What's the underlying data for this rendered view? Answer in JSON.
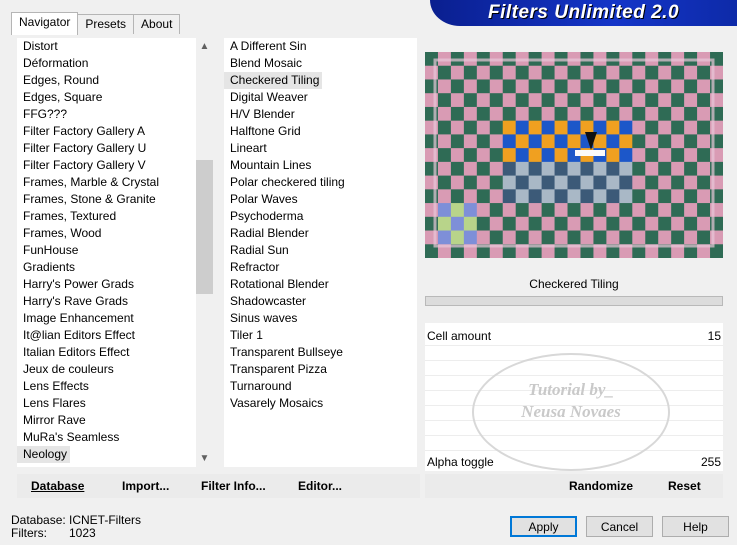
{
  "app": {
    "title": "Filters Unlimited 2.0"
  },
  "tabs": [
    {
      "label": "Navigator"
    },
    {
      "label": "Presets"
    },
    {
      "label": "About"
    }
  ],
  "categories": [
    "Distort",
    "Déformation",
    "Edges, Round",
    "Edges, Square",
    "FFG???",
    "Filter Factory Gallery A",
    "Filter Factory Gallery U",
    "Filter Factory Gallery V",
    "Frames, Marble & Crystal",
    "Frames, Stone & Granite",
    "Frames, Textured",
    "Frames, Wood",
    "FunHouse",
    "Gradients",
    "Harry's Power Grads",
    "Harry's Rave Grads",
    "Image Enhancement",
    "It@lian Editors Effect",
    "Italian Editors Effect",
    "Jeux de couleurs",
    "Lens Effects",
    "Lens Flares",
    "Mirror Rave",
    "MuRa's Seamless",
    "Neology"
  ],
  "filters": [
    "A Different Sin",
    "Blend Mosaic",
    "Checkered Tiling",
    "Digital Weaver",
    "H/V Blender",
    "Halftone Grid",
    "Lineart",
    "Mountain Lines",
    "Polar checkered tiling",
    "Polar Waves",
    "Psychoderma",
    "Radial Blender",
    "Radial Sun",
    "Refractor",
    "Rotational Blender",
    "Shadowcaster",
    "Sinus waves",
    "Tiler 1",
    "Transparent Bullseye",
    "Transparent Pizza",
    "Turnaround",
    "Vasarely Mosaics"
  ],
  "selected": {
    "category": "Neology",
    "filter": "Checkered Tiling"
  },
  "filter_name": "Checkered Tiling",
  "params": [
    {
      "label": "Cell amount",
      "value": "15"
    },
    {
      "label": "Alpha toggle",
      "value": "255"
    }
  ],
  "watermark": {
    "line1": "Tutorial by_",
    "line2": "Neusa Novaes"
  },
  "toolbar": {
    "database": "Database",
    "import": "Import...",
    "filter_info": "Filter Info...",
    "editor": "Editor...",
    "randomize": "Randomize",
    "reset": "Reset"
  },
  "status": {
    "database_label": "Database:",
    "database_value": "ICNET-Filters",
    "filters_label": "Filters:",
    "filters_value": "1023"
  },
  "buttons": {
    "apply": "Apply",
    "cancel": "Cancel",
    "help": "Help"
  },
  "icons": {
    "scroll_up": "chevron-up-icon",
    "scroll_down": "chevron-down-icon"
  },
  "colors": {
    "accent": "#0078d7",
    "banner": "#1435c8",
    "checker_a": "#2f6b55",
    "checker_b": "#d99bb4"
  }
}
